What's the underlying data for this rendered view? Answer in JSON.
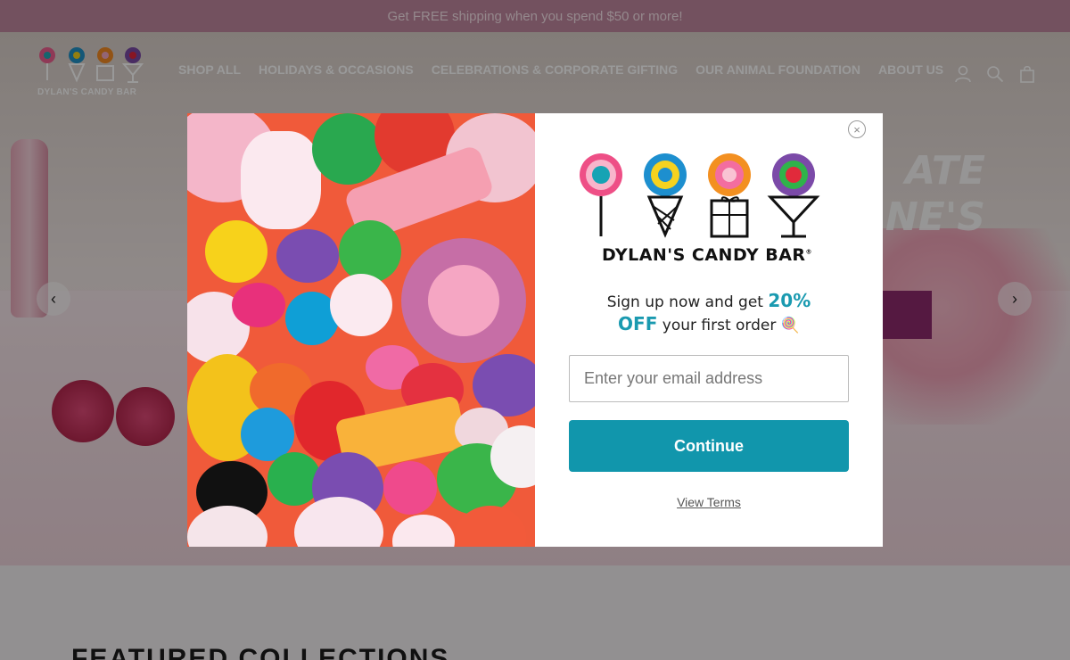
{
  "announcement": {
    "text": "Get FREE shipping when you spend $50 or more!"
  },
  "header": {
    "logo_text": "DYLAN'S CANDY BAR",
    "nav": [
      {
        "label": "SHOP ALL"
      },
      {
        "label": "HOLIDAYS & OCCASIONS"
      },
      {
        "label": "CELEBRATIONS & CORPORATE GIFTING"
      },
      {
        "label": "OUR ANIMAL FOUNDATION"
      },
      {
        "label": "ABOUT US"
      }
    ],
    "icons": [
      "account-icon",
      "search-icon",
      "bag-icon"
    ]
  },
  "hero": {
    "heading_line1": "ATE",
    "heading_line2": "NE'S",
    "prev_arrow": "‹",
    "next_arrow": "›"
  },
  "featured": {
    "title": "FEATURED COLLECTIONS"
  },
  "popup": {
    "close_label": "×",
    "brand_name": "DYLAN'S CANDY BAR",
    "brand_mark": "®",
    "offer_prefix": "Sign up now and get",
    "offer_highlight_1": "20%",
    "offer_highlight_2": "OFF",
    "offer_suffix": "your first order",
    "offer_emoji": "🍭",
    "email_placeholder": "Enter your email address",
    "continue_label": "Continue",
    "terms_label": "View Terms"
  },
  "colors": {
    "announcement_bg": "#c0879e",
    "accent": "#1a9ab0",
    "button": "#1196ac"
  }
}
